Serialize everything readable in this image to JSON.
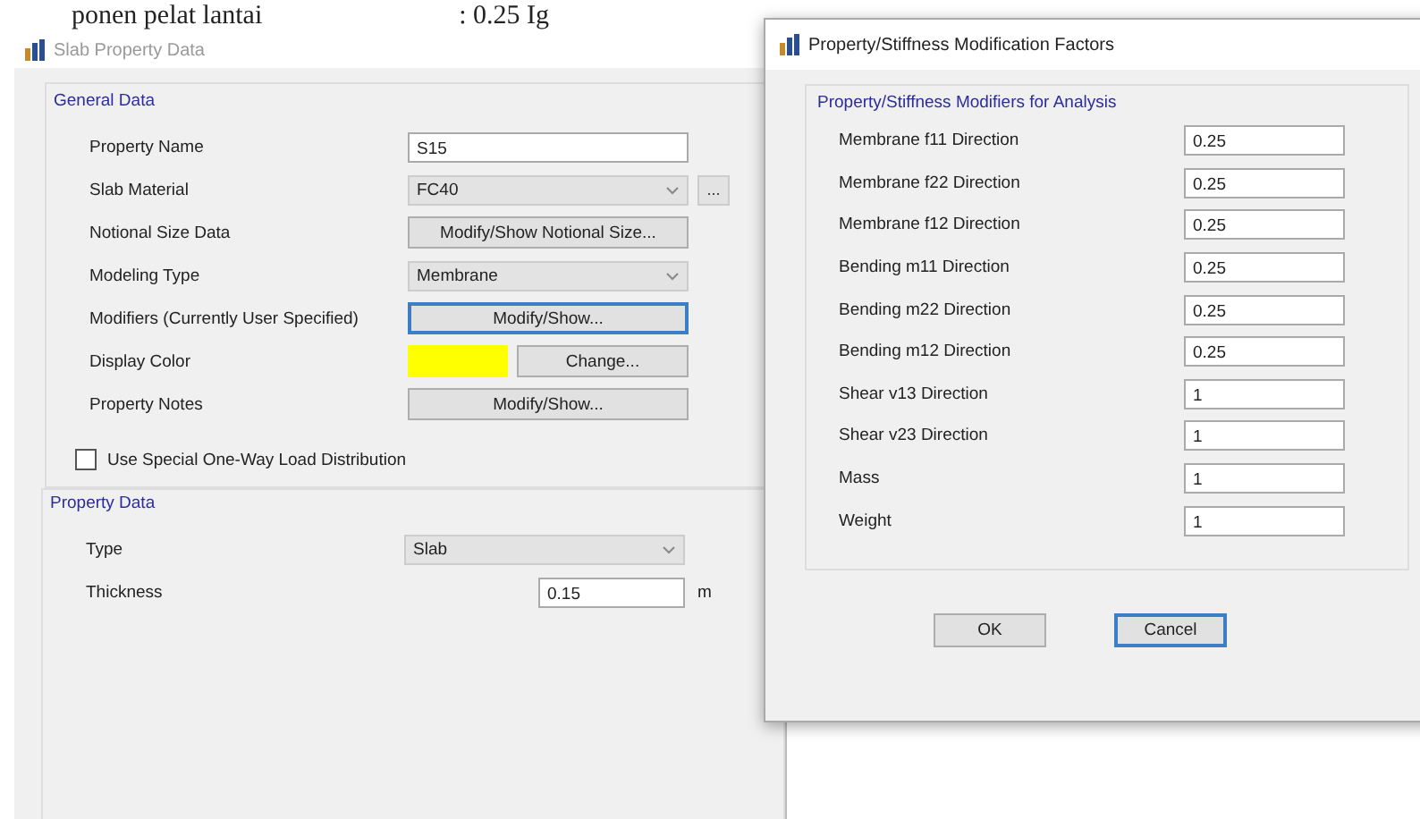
{
  "doc_text": {
    "left": "ponen pelat lantai",
    "right": ": 0.25 Ig"
  },
  "slab_dialog": {
    "title": "Slab Property Data",
    "general_data": {
      "title": "General Data",
      "rows": [
        {
          "label": "Property Name",
          "kind": "text",
          "value": "S15"
        },
        {
          "label": "Slab Material",
          "kind": "dropdown",
          "value": "FC40",
          "extra": "..."
        },
        {
          "label": "Notional Size Data",
          "kind": "button",
          "value": "Modify/Show Notional Size...",
          "focused": false
        },
        {
          "label": "Modeling Type",
          "kind": "dropdown",
          "value": "Membrane"
        },
        {
          "label": "Modifiers (Currently User Specified)",
          "kind": "button",
          "value": "Modify/Show...",
          "focused": true
        },
        {
          "label": "Display Color",
          "kind": "color",
          "value": "Change...",
          "color": "#ffff00"
        },
        {
          "label": "Property Notes",
          "kind": "button",
          "value": "Modify/Show...",
          "focused": false
        }
      ]
    },
    "checkbox": {
      "label": "Use Special One-Way Load Distribution",
      "checked": false
    },
    "property_data": {
      "title": "Property Data",
      "rows": [
        {
          "label": "Type",
          "kind": "dropdown",
          "value": "Slab"
        },
        {
          "label": "Thickness",
          "kind": "unit",
          "value": "0.15",
          "unit": "m"
        }
      ]
    }
  },
  "modifiers_dialog": {
    "title": "Property/Stiffness Modification Factors",
    "group_title": "Property/Stiffness Modifiers for Analysis",
    "rows": [
      {
        "label": "Membrane f11 Direction",
        "value": "0.25"
      },
      {
        "label": "Membrane f22 Direction",
        "value": "0.25"
      },
      {
        "label": "Membrane f12 Direction",
        "value": "0.25"
      },
      {
        "label": "Bending m11 Direction",
        "value": "0.25"
      },
      {
        "label": "Bending m22 Direction",
        "value": "0.25"
      },
      {
        "label": "Bending m12 Direction",
        "value": "0.25"
      },
      {
        "label": "Shear v13 Direction",
        "value": "1"
      },
      {
        "label": "Shear v23 Direction",
        "value": "1"
      },
      {
        "label": "Mass",
        "value": "1"
      },
      {
        "label": "Weight",
        "value": "1"
      }
    ],
    "buttons": [
      {
        "label": "OK",
        "focused": false
      },
      {
        "label": "Cancel",
        "focused": true
      }
    ]
  }
}
